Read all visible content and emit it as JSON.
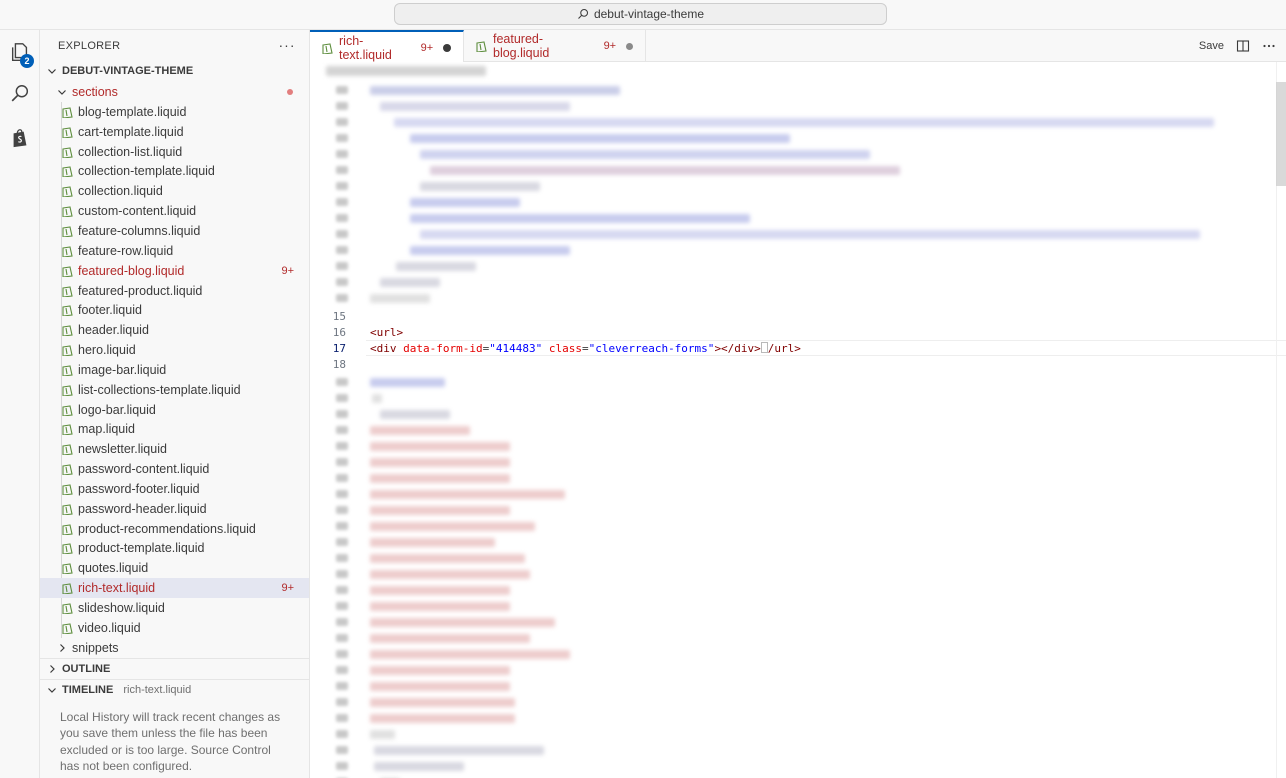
{
  "window": {
    "search_text": "debut-vintage-theme"
  },
  "activity_bar": {
    "explorer_badge": "2"
  },
  "explorer": {
    "header": "EXPLORER",
    "more_label": "···",
    "workspace": "DEBUT-VINTAGE-THEME",
    "folder": "sections",
    "files": [
      {
        "name": "blog-template.liquid",
        "count": ""
      },
      {
        "name": "cart-template.liquid",
        "count": ""
      },
      {
        "name": "collection-list.liquid",
        "count": ""
      },
      {
        "name": "collection-template.liquid",
        "count": ""
      },
      {
        "name": "collection.liquid",
        "count": ""
      },
      {
        "name": "custom-content.liquid",
        "count": ""
      },
      {
        "name": "feature-columns.liquid",
        "count": ""
      },
      {
        "name": "feature-row.liquid",
        "count": ""
      },
      {
        "name": "featured-blog.liquid",
        "count": "9+"
      },
      {
        "name": "featured-product.liquid",
        "count": ""
      },
      {
        "name": "footer.liquid",
        "count": ""
      },
      {
        "name": "header.liquid",
        "count": ""
      },
      {
        "name": "hero.liquid",
        "count": ""
      },
      {
        "name": "image-bar.liquid",
        "count": ""
      },
      {
        "name": "list-collections-template.liquid",
        "count": ""
      },
      {
        "name": "logo-bar.liquid",
        "count": ""
      },
      {
        "name": "map.liquid",
        "count": ""
      },
      {
        "name": "newsletter.liquid",
        "count": ""
      },
      {
        "name": "password-content.liquid",
        "count": ""
      },
      {
        "name": "password-footer.liquid",
        "count": ""
      },
      {
        "name": "password-header.liquid",
        "count": ""
      },
      {
        "name": "product-recommendations.liquid",
        "count": ""
      },
      {
        "name": "product-template.liquid",
        "count": ""
      },
      {
        "name": "quotes.liquid",
        "count": ""
      },
      {
        "name": "rich-text.liquid",
        "count": "9+"
      },
      {
        "name": "slideshow.liquid",
        "count": ""
      },
      {
        "name": "video.liquid",
        "count": ""
      }
    ],
    "snippets_folder": "snippets",
    "outline_label": "OUTLINE",
    "timeline_label": "TIMELINE",
    "timeline_file": "rich-text.liquid",
    "timeline_message": "Local History will track recent changes as you save them unless the file has been excluded or is too large. Source Control has not been configured."
  },
  "tabs": [
    {
      "label": "rich-text.liquid",
      "count": "9+"
    },
    {
      "label": "featured-blog.liquid",
      "count": "9+"
    }
  ],
  "editor_actions": {
    "save_label": "Save"
  },
  "editor": {
    "lines": [
      {
        "number": "15",
        "text": ""
      },
      {
        "number": "16",
        "text": "<url>"
      },
      {
        "number": "17",
        "text": "<div data-form-id=\"414483\" class=\"cleverreach-forms\"></div></url>"
      },
      {
        "number": "18",
        "text": ""
      }
    ],
    "line16": {
      "open": "<",
      "tag": "url",
      "close": ">"
    },
    "line17": {
      "lt": "<",
      "tag": "div",
      "attr1": "data-form-id",
      "eq1": "=",
      "val1": "\"414483\"",
      "attr2": "class",
      "eq2": "=",
      "val2": "\"cleverreach-forms\"",
      "close_div": "></div>",
      "end_url": "/url>"
    }
  },
  "colors": {
    "accent": "#005fb8",
    "modified": "#b12a2a",
    "selection": "#e4e6f1",
    "shopify_green": "#5e8e3e"
  }
}
